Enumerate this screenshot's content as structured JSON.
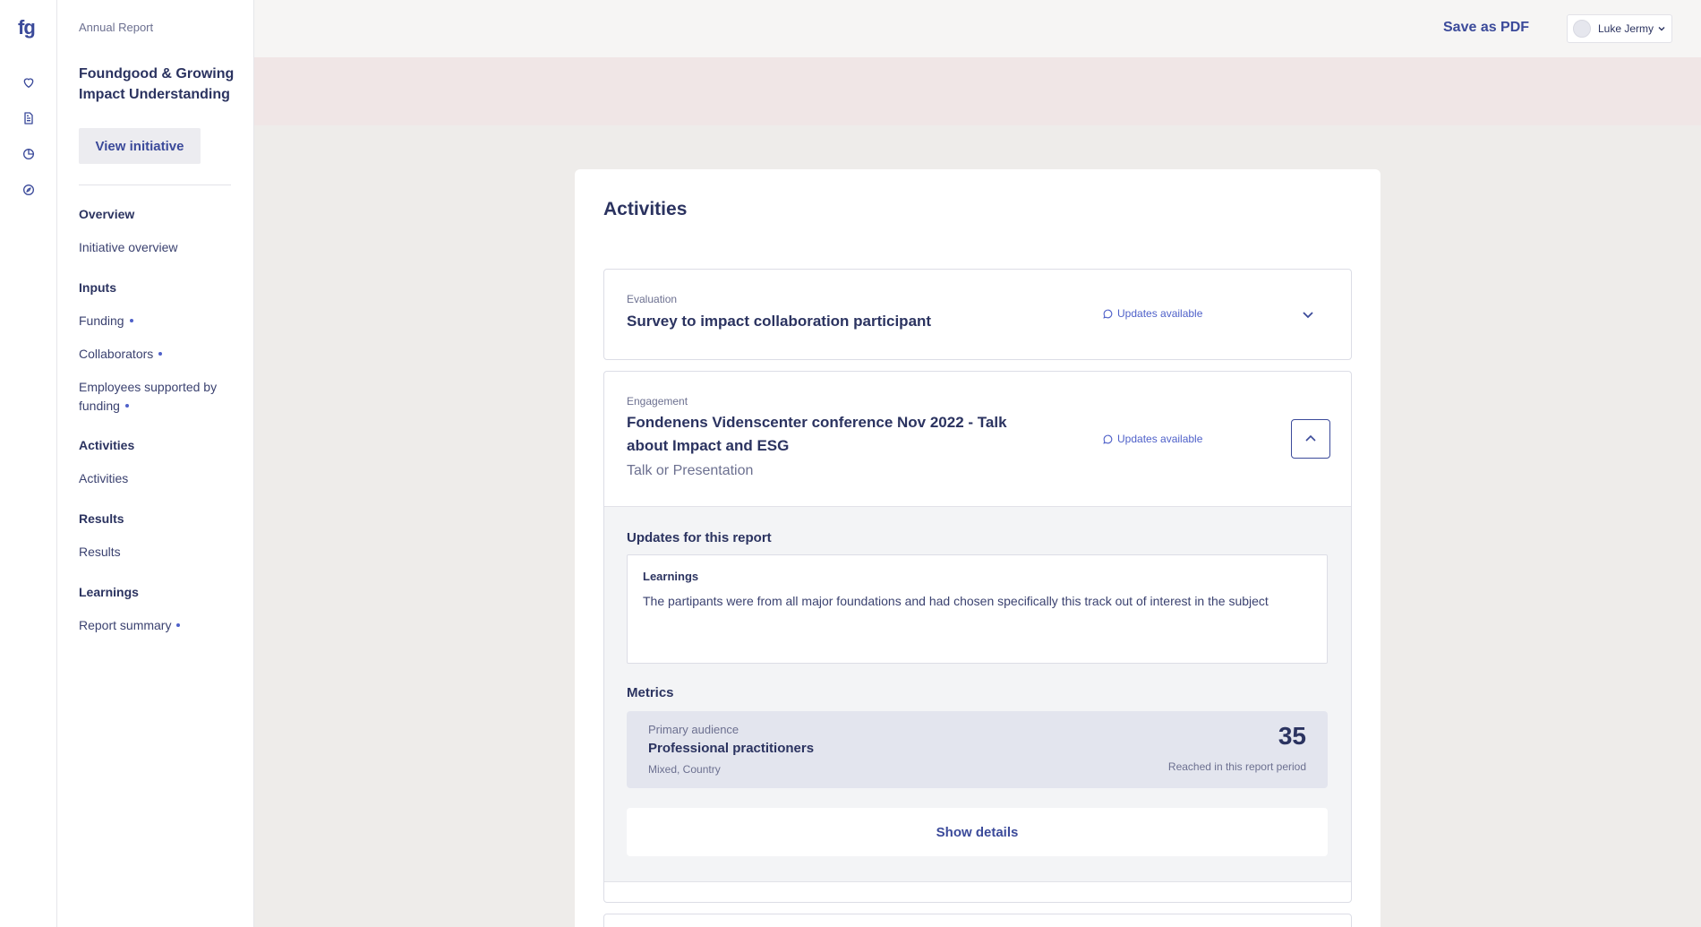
{
  "rail": {
    "logo": "fg",
    "icons": [
      "heart-icon",
      "document-icon",
      "pie-chart-icon",
      "compass-icon"
    ]
  },
  "sidenav": {
    "crumb": "Annual Report",
    "title": "Foundgood & Growing Impact Understanding",
    "view_button": "View initiative",
    "sections": [
      {
        "heading": "Overview",
        "items": [
          {
            "label": "Initiative overview",
            "dot": false
          }
        ]
      },
      {
        "heading": "Inputs",
        "items": [
          {
            "label": "Funding",
            "dot": true
          },
          {
            "label": "Collaborators",
            "dot": true
          },
          {
            "label": "Employees supported by funding",
            "dot": true
          }
        ]
      },
      {
        "heading": "Activities",
        "items": [
          {
            "label": "Activities",
            "dot": false
          }
        ]
      },
      {
        "heading": "Results",
        "items": [
          {
            "label": "Results",
            "dot": false
          }
        ]
      },
      {
        "heading": "Learnings",
        "items": [
          {
            "label": "Report summary",
            "dot": true
          }
        ]
      }
    ]
  },
  "header": {
    "save_pdf": "Save as PDF",
    "user_name": "Luke Jermy"
  },
  "main": {
    "title": "Activities",
    "activities": [
      {
        "category": "Evaluation",
        "title": "Survey to impact collaboration participant",
        "updates": "Updates available"
      },
      {
        "category": "Engagement",
        "title": "Fondenens Videnscenter conference Nov 2022 - Talk about Impact and ESG",
        "subtitle": "Talk or Presentation",
        "updates": "Updates available",
        "updates_title": "Updates for this report",
        "learnings_label": "Learnings",
        "learnings_text": "The partipants were from all major foundations and had chosen specifically this track out of interest in the subject",
        "metrics_title": "Metrics",
        "metric": {
          "label": "Primary audience",
          "name": "Professional practitioners",
          "meta": "Mixed, Country",
          "value": "35",
          "caption": "Reached in this report period"
        },
        "show_details": "Show details"
      }
    ]
  }
}
